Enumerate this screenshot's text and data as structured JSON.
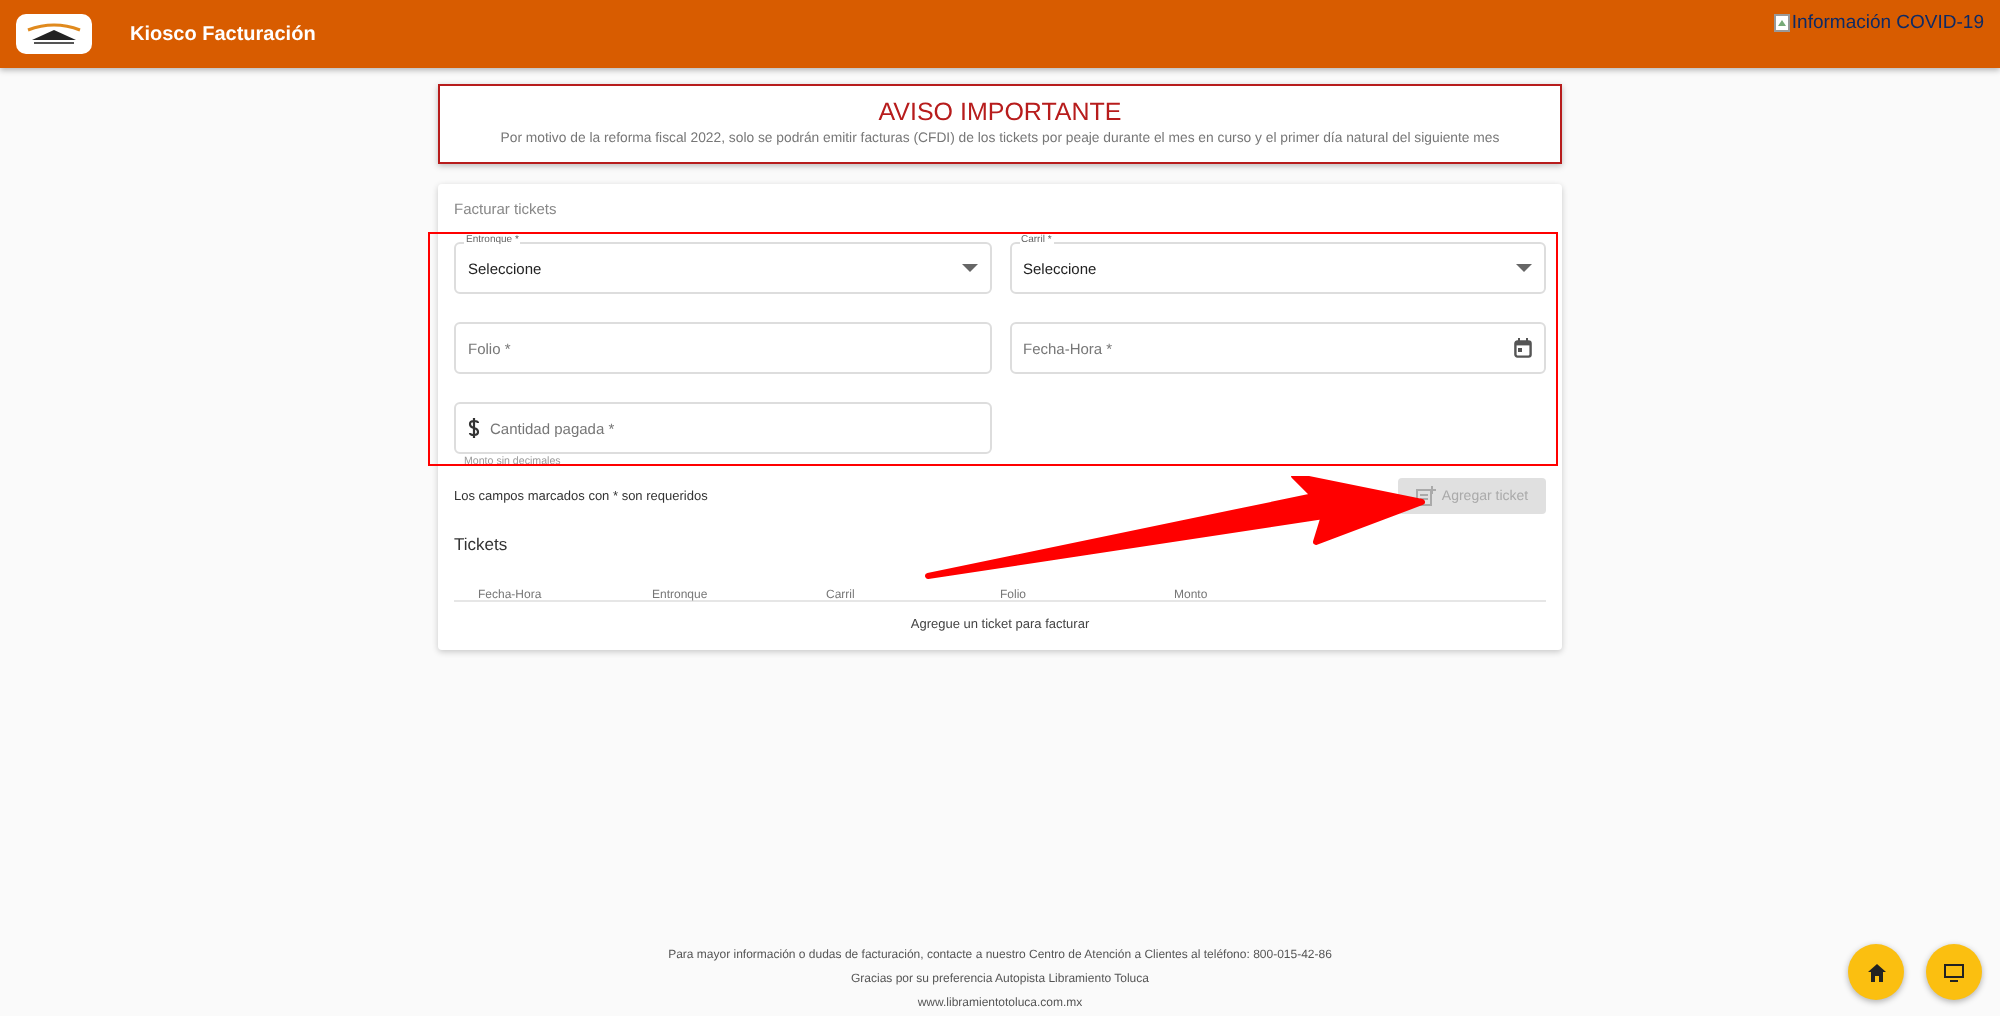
{
  "header": {
    "title": "Kiosco Facturación",
    "broken_image_alt": "Información COVID-19"
  },
  "notice": {
    "title": "AVISO IMPORTANTE",
    "text": "Por motivo de la reforma fiscal 2022, solo se podrán emitir facturas (CFDI) de los tickets por peaje durante el mes en curso y el primer día natural del siguiente mes"
  },
  "form": {
    "title": "Facturar tickets",
    "fields": [
      {
        "kind": "select",
        "label": "Entronque *",
        "value": "Seleccione"
      },
      {
        "kind": "select",
        "label": "Carril *",
        "value": "Seleccione"
      },
      {
        "kind": "text",
        "placeholder": "Folio *"
      },
      {
        "kind": "date",
        "placeholder": "Fecha-Hora *"
      },
      {
        "kind": "money",
        "placeholder": "Cantidad pagada *",
        "hint": "Monto sin decimales"
      }
    ],
    "required_note": "Los campos marcados con * son requeridos",
    "add_button": {
      "label": "Agregar ticket",
      "disabled": true
    }
  },
  "tickets": {
    "title": "Tickets",
    "columns": [
      "Fecha-Hora",
      "Entronque",
      "Carril",
      "Folio",
      "Monto"
    ],
    "empty_text": "Agregue un ticket para facturar"
  },
  "footer": [
    "Para mayor información o dudas de facturación, contacte a nuestro Centro de Atención a Clientes al teléfono: 800-015-42-86",
    "Gracias por su preferencia Autopista Libramiento Toluca",
    "www.libramientotoluca.com.mx"
  ]
}
